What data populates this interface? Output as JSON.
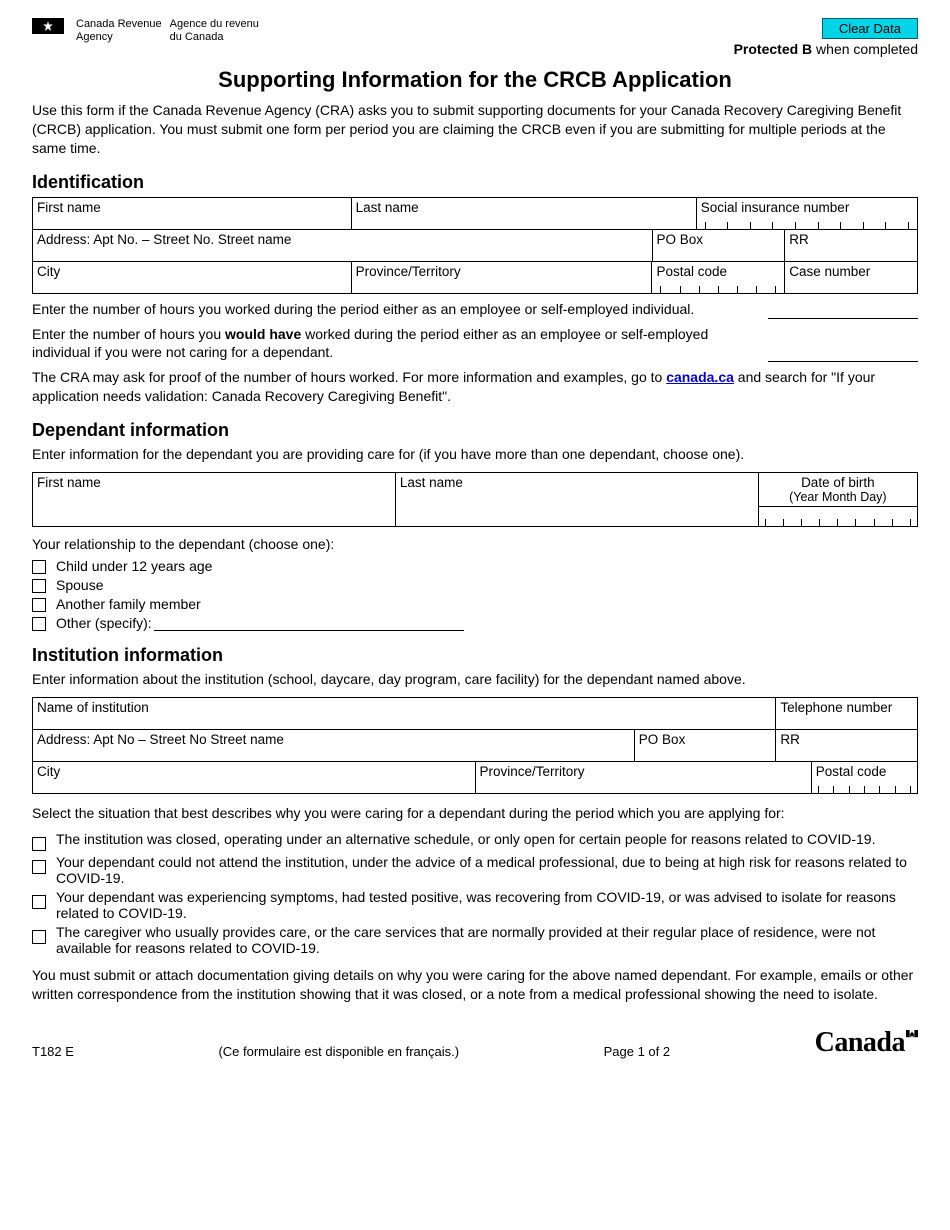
{
  "header": {
    "agency_en_1": "Canada Revenue",
    "agency_en_2": "Agency",
    "agency_fr_1": "Agence du revenu",
    "agency_fr_2": "du Canada",
    "clear_data": "Clear Data",
    "protected_b": "Protected B",
    "protected_suffix": " when completed"
  },
  "title": "Supporting Information for the CRCB Application",
  "intro": "Use this form if the Canada Revenue Agency (CRA) asks you to submit supporting documents for your Canada Recovery Caregiving Benefit (CRCB) application. You must submit one form per period you are claiming the CRCB even if you are submitting for multiple periods at the same time.",
  "identification": {
    "heading": "Identification",
    "first_name": "First name",
    "last_name": "Last name",
    "sin": "Social insurance number",
    "address": "Address: Apt No.  –  Street No.    Street name",
    "po_box": "PO Box",
    "rr": "RR",
    "city": "City",
    "province": "Province/Territory",
    "postal_code": "Postal code",
    "case_number": "Case number"
  },
  "hours": {
    "q1": "Enter the number of hours you worked during the period either as an employee or self-employed individual.",
    "q2_pre": "Enter the number of hours you ",
    "q2_bold": "would have",
    "q2_post": " worked during the period either as an employee or self-employed individual if you were not caring for a dependant.",
    "proof_pre": "The CRA may ask for proof of the number of hours worked. For more information and examples, go to ",
    "proof_link": "canada.ca",
    "proof_post": " and search for \"If your application needs validation: Canada Recovery Caregiving Benefit\"."
  },
  "dependant": {
    "heading": "Dependant information",
    "intro": "Enter information for the dependant you are providing care for (if you have more than one dependant, choose one).",
    "first_name": "First name",
    "last_name": "Last name",
    "dob": "Date of birth",
    "dob_fmt": "(Year  Month  Day)",
    "relationship_prompt": "Your relationship to the dependant (choose one):",
    "opt_child": "Child under 12 years age",
    "opt_spouse": "Spouse",
    "opt_family": "Another family member",
    "opt_other": "Other (specify):"
  },
  "institution": {
    "heading": "Institution information",
    "intro": "Enter information about the institution (school, daycare, day program, care facility) for the dependant named above.",
    "name": "Name of institution",
    "telephone": "Telephone number",
    "address": "Address: Apt No  –  Street No    Street name",
    "po_box": "PO Box",
    "rr": "RR",
    "city": "City",
    "province": "Province/Territory",
    "postal_code": "Postal code",
    "situation_prompt": "Select the situation that best describes why you were caring for a dependant during the period which you are applying for:",
    "opt1": "The institution was closed, operating under an alternative schedule, or only open for certain people for reasons related to COVID-19.",
    "opt2": "Your dependant could not attend the institution, under the advice of a medical professional, due to being at high risk for reasons related to COVID-19.",
    "opt3": "Your dependant was experiencing symptoms, had tested positive, was recovering from COVID-19, or was advised to isolate for reasons related to COVID-19.",
    "opt4": "The caregiver who usually provides care, or the care services that are normally provided at their regular place of residence, were not available for reasons related to COVID-19.",
    "submit_note": "You must submit or attach documentation giving details on why you were caring for the above named dependant. For example, emails or other written correspondence from the institution showing that it was closed, or a note from a medical professional showing the need to isolate."
  },
  "footer": {
    "form_no": "T182 E",
    "french": "(Ce formulaire est disponible en français.)",
    "page": "Page 1 of 2",
    "wordmark": "Canada"
  }
}
